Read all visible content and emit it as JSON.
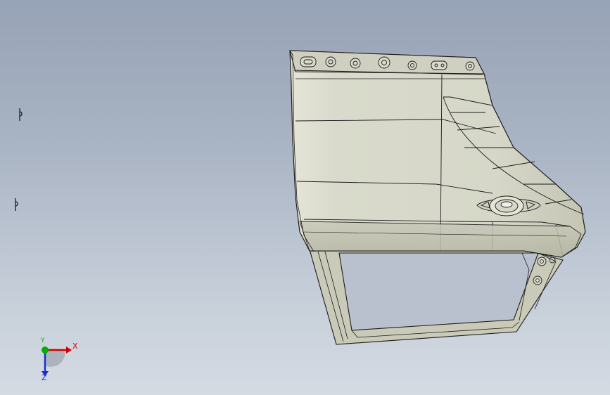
{
  "viewport": {
    "background_top": "#97a3b6",
    "background_bottom": "#d4dbe3"
  },
  "model": {
    "part_color": "#d3d4c4",
    "edge_color": "#1c1c1c",
    "shadow_color": "#a9aa98"
  },
  "triad": {
    "x_label": "X",
    "y_label": "Y",
    "z_label": "Z",
    "x_color": "#d40000",
    "y_color": "#00b000",
    "z_color": "#1a2fd0"
  }
}
